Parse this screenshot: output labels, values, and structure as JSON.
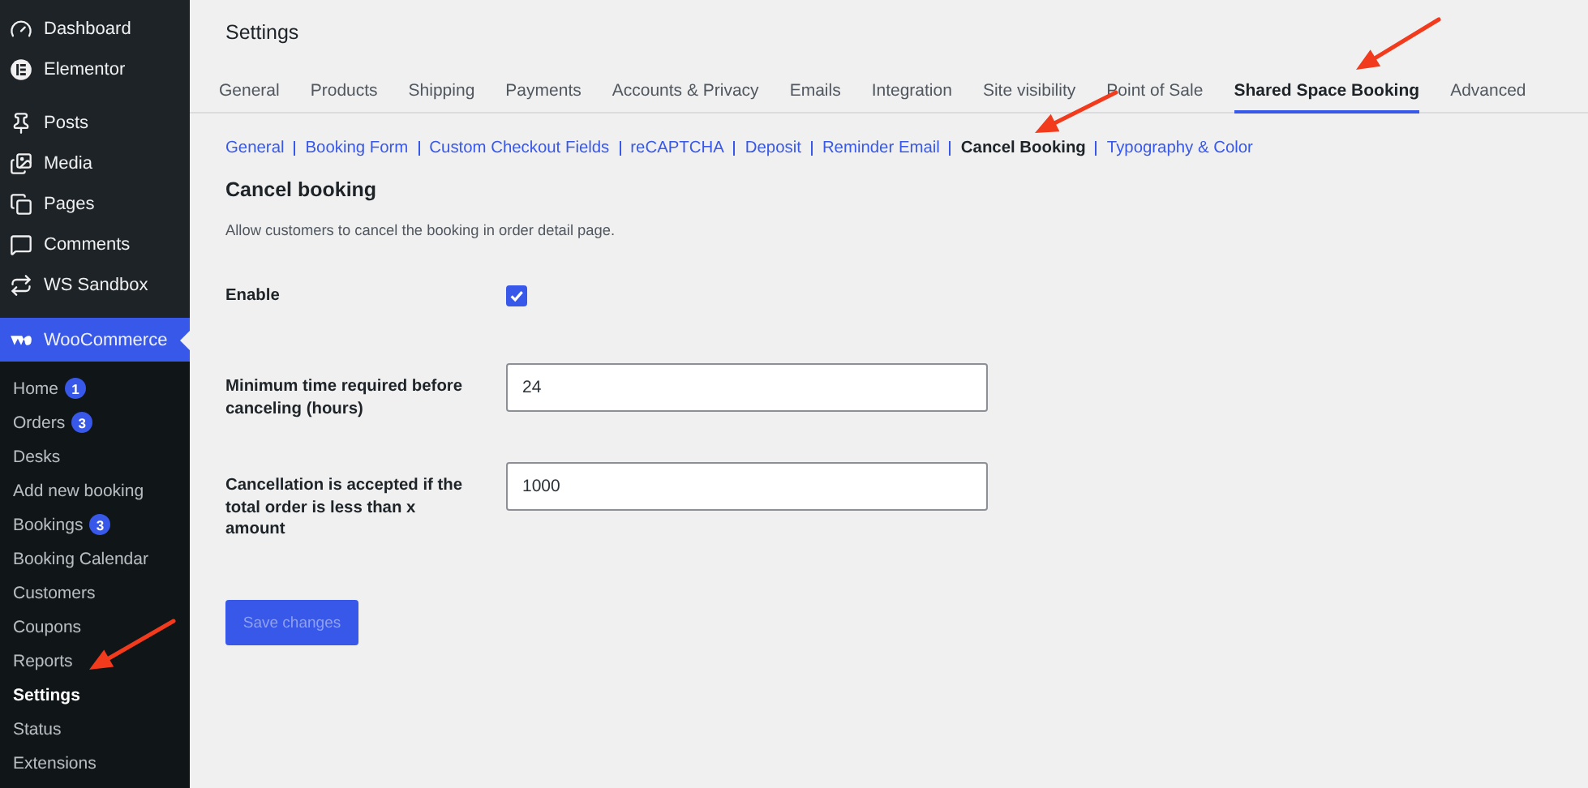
{
  "sidebar": {
    "menu": [
      {
        "label": "Dashboard",
        "selected": false
      },
      {
        "label": "Elementor",
        "selected": false
      },
      {
        "label": "Posts",
        "selected": false
      },
      {
        "label": "Media",
        "selected": false
      },
      {
        "label": "Pages",
        "selected": false
      },
      {
        "label": "Comments",
        "selected": false
      },
      {
        "label": "WS Sandbox",
        "selected": false
      },
      {
        "label": "WooCommerce",
        "selected": true
      }
    ],
    "submenu": [
      {
        "label": "Home",
        "badge": "1",
        "selected": false
      },
      {
        "label": "Orders",
        "badge": "3",
        "selected": false
      },
      {
        "label": "Desks",
        "selected": false
      },
      {
        "label": "Add new booking",
        "selected": false
      },
      {
        "label": "Bookings",
        "badge": "3",
        "selected": false
      },
      {
        "label": "Booking Calendar",
        "selected": false
      },
      {
        "label": "Customers",
        "selected": false
      },
      {
        "label": "Coupons",
        "selected": false
      },
      {
        "label": "Reports",
        "selected": false
      },
      {
        "label": "Settings",
        "selected": true
      },
      {
        "label": "Status",
        "selected": false
      },
      {
        "label": "Extensions",
        "selected": false
      }
    ]
  },
  "main": {
    "title": "Settings",
    "tabs": [
      {
        "label": "General",
        "selected": false
      },
      {
        "label": "Products",
        "selected": false
      },
      {
        "label": "Shipping",
        "selected": false
      },
      {
        "label": "Payments",
        "selected": false
      },
      {
        "label": "Accounts & Privacy",
        "selected": false
      },
      {
        "label": "Emails",
        "selected": false
      },
      {
        "label": "Integration",
        "selected": false
      },
      {
        "label": "Site visibility",
        "selected": false
      },
      {
        "label": "Point of Sale",
        "selected": false
      },
      {
        "label": "Shared Space Booking",
        "selected": true
      },
      {
        "label": "Advanced",
        "selected": false
      }
    ],
    "subtabs": [
      {
        "label": "General",
        "selected": false
      },
      {
        "label": "Booking Form",
        "selected": false
      },
      {
        "label": "Custom Checkout Fields",
        "selected": false
      },
      {
        "label": "reCAPTCHA",
        "selected": false
      },
      {
        "label": "Deposit",
        "selected": false
      },
      {
        "label": "Reminder Email",
        "selected": false
      },
      {
        "label": "Cancel Booking",
        "selected": true
      },
      {
        "label": "Typography & Color",
        "selected": false
      }
    ],
    "heading": "Cancel booking",
    "description": "Allow customers to cancel the booking in order detail page.",
    "fields": [
      {
        "kind": "checkbox",
        "label": "Enable",
        "checked": true
      },
      {
        "kind": "text",
        "label": "Minimum time required before canceling (hours)",
        "value": "24"
      },
      {
        "kind": "text",
        "label": "Cancellation is accepted if the total order is less than x amount",
        "value": "1000"
      }
    ],
    "save_button": {
      "label": "Save changes",
      "disabled": true
    }
  }
}
